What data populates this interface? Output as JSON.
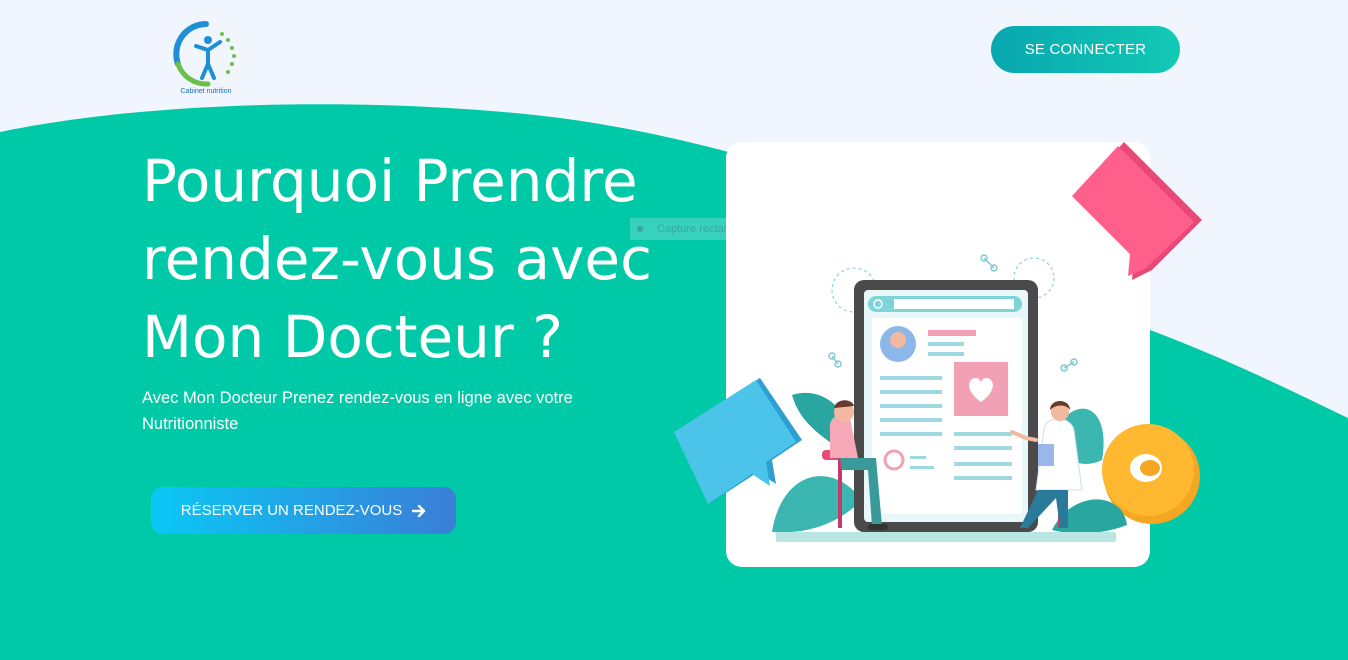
{
  "brand": {
    "logo_text": "Cabinet nutrition"
  },
  "header": {
    "login_label": "SE CONNECTER"
  },
  "hero": {
    "title_line1": "Pourquoi Prendre",
    "title_line2": "rendez-vous avec",
    "title_line3": "Mon Docteur ?",
    "subtitle": "Avec Mon Docteur Prenez rendez-vous en ligne avec votre Nutritionniste",
    "cta_label": "RÉSERVER UN RENDEZ-VOUS"
  },
  "overlay": {
    "capture_label": "Capture rectangulaire"
  },
  "colors": {
    "background": "#f0f5fe",
    "teal": "#00c9a7",
    "login_gradient": [
      "#08a7b0",
      "#13c9b4"
    ],
    "cta_gradient": [
      "#0ac8f5",
      "#3a7ed8"
    ]
  },
  "icons": {
    "logo": "nutrition-person-logo",
    "cta": "arrow-right-icon",
    "illustration": "doctor-consultation-tablet"
  }
}
